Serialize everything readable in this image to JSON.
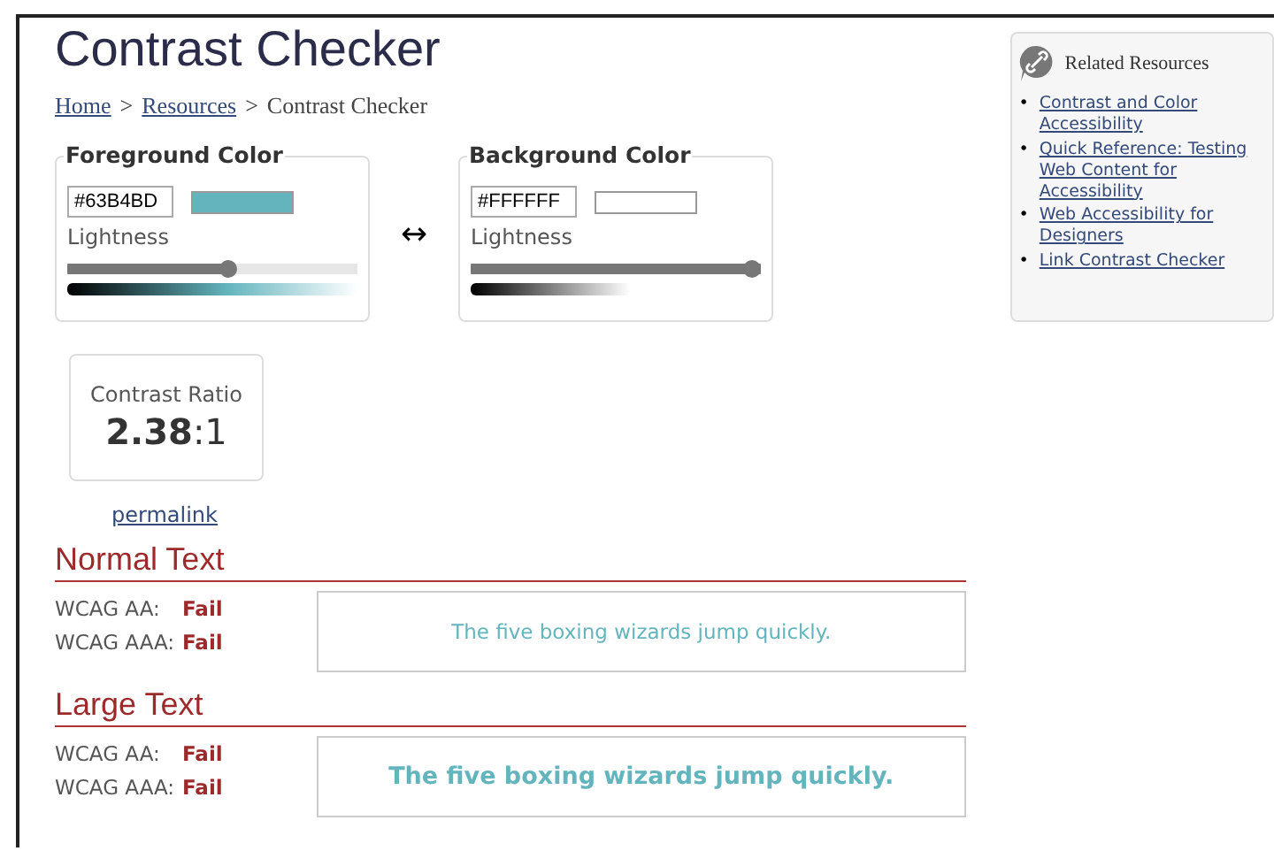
{
  "title": "Contrast Checker",
  "breadcrumb": [
    {
      "label": "Home",
      "link": true
    },
    {
      "label": ">",
      "link": false
    },
    {
      "label": "Resources",
      "link": true
    },
    {
      "label": ">",
      "link": false
    },
    {
      "label": "Contrast Checker",
      "link": false
    }
  ],
  "pickers": [
    {
      "legend": "Foreground Color",
      "value": "#63B4BD",
      "slider_label": "Lightness",
      "level": 0.56
    },
    {
      "legend": "Background Color",
      "value": "#FFFFFF",
      "slider_label": "Lightness",
      "level": 1.0
    }
  ],
  "swap": "↔",
  "ratio": {
    "label": "Contrast Ratio",
    "value": "**2.38**:1"
  },
  "permalink": "permalink",
  "sections": [
    {
      "heading": "Normal Text",
      "large": false,
      "results": [
        {
          "label": "WCAG AA:",
          "result": "Fail"
        },
        {
          "label": "WCAG AAA:",
          "result": "Fail"
        }
      ],
      "sample": "The five boxing wizards jump quickly."
    },
    {
      "heading": "Large Text",
      "large": true,
      "results": [
        {
          "label": "WCAG AA:",
          "result": "Fail"
        },
        {
          "label": "WCAG AAA:",
          "result": "Fail"
        }
      ],
      "sample": "The five boxing wizards jump quickly."
    }
  ],
  "sidebar": {
    "title": "Related Resources",
    "links": [
      {
        "bullet": "•",
        "label": "Contrast and Color Accessibility"
      },
      {
        "bullet": "•",
        "label": "Quick Reference: Testing Web Content for Accessibility"
      },
      {
        "bullet": "•",
        "label": "Web Accessibility for Designers"
      },
      {
        "bullet": "•",
        "label": "Link Contrast Checker"
      }
    ]
  }
}
